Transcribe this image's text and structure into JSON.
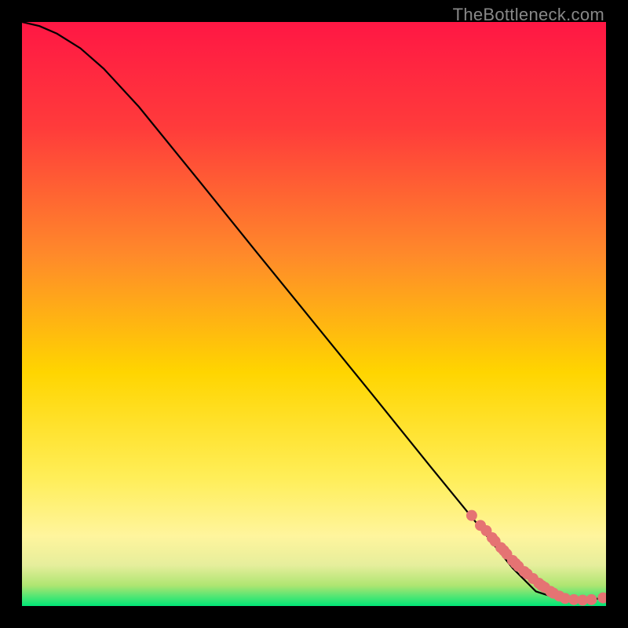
{
  "watermark": "TheBottleneck.com",
  "chart_data": {
    "type": "line",
    "title": "",
    "xlabel": "",
    "ylabel": "",
    "xlim": [
      0,
      100
    ],
    "ylim": [
      0,
      100
    ],
    "grid": false,
    "legend": false,
    "background_gradient_stops": [
      {
        "offset": 0.0,
        "color": "#ff1744"
      },
      {
        "offset": 0.18,
        "color": "#ff3b3b"
      },
      {
        "offset": 0.4,
        "color": "#ff8a2a"
      },
      {
        "offset": 0.6,
        "color": "#ffd500"
      },
      {
        "offset": 0.78,
        "color": "#ffee58"
      },
      {
        "offset": 0.88,
        "color": "#fff59d"
      },
      {
        "offset": 0.93,
        "color": "#e6ee9c"
      },
      {
        "offset": 0.965,
        "color": "#aee571"
      },
      {
        "offset": 1.0,
        "color": "#00e676"
      }
    ],
    "series": [
      {
        "name": "bottleneck-curve",
        "type": "line",
        "color": "#000000",
        "x": [
          0,
          3,
          6,
          10,
          14,
          20,
          30,
          40,
          50,
          60,
          70,
          78,
          84,
          88,
          92,
          96,
          100
        ],
        "y": [
          100,
          99.3,
          98.0,
          95.5,
          92.0,
          85.5,
          73.2,
          60.8,
          48.5,
          36.2,
          23.8,
          14.0,
          6.5,
          2.5,
          1.2,
          1.0,
          1.4
        ]
      },
      {
        "name": "highlight-points",
        "type": "scatter",
        "color": "#e57373",
        "radius": 7,
        "x": [
          77,
          78.5,
          79.5,
          80.5,
          81,
          82,
          82.5,
          83,
          84,
          84.5,
          85,
          86,
          86.5,
          87.5,
          88.5,
          89,
          89.5,
          90.5,
          91,
          92,
          93,
          94.5,
          96,
          97.5,
          99.5
        ],
        "y": [
          15.5,
          13.8,
          12.9,
          11.7,
          11.1,
          10.0,
          9.5,
          8.9,
          7.8,
          7.3,
          6.8,
          5.9,
          5.5,
          4.7,
          3.9,
          3.5,
          3.2,
          2.5,
          2.2,
          1.7,
          1.3,
          1.1,
          1.0,
          1.1,
          1.4
        ]
      }
    ]
  }
}
